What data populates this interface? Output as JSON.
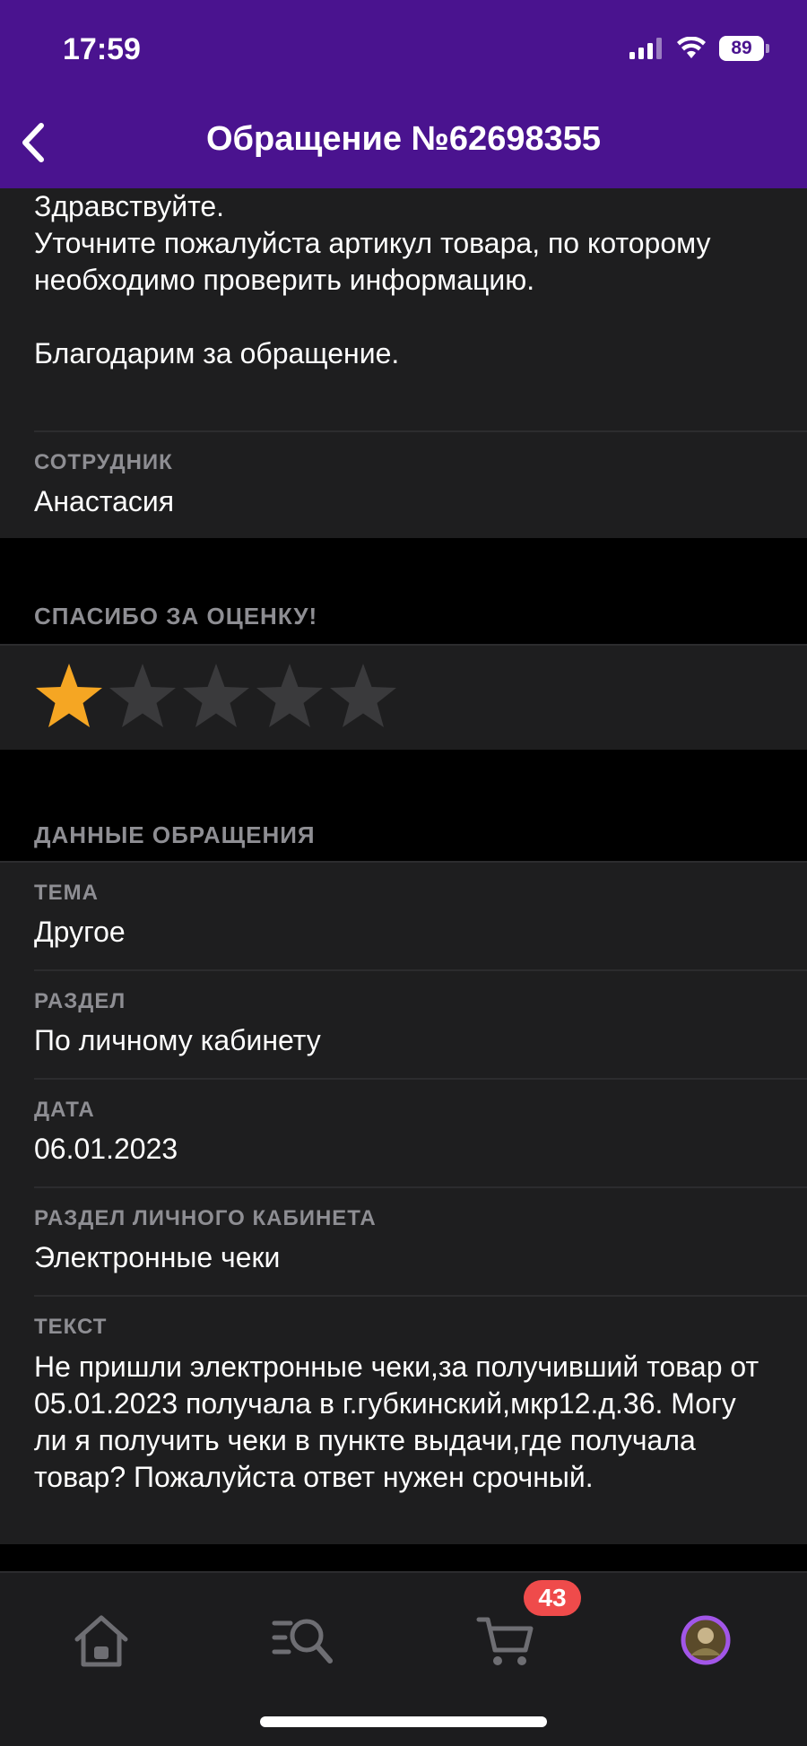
{
  "status_bar": {
    "time": "17:59",
    "battery": "89"
  },
  "header": {
    "title": "Обращение №62698355"
  },
  "response": {
    "message": "Здравствуйте.\nУточните пожалуйста артикул товара, по которому необходимо проверить информацию.\n\nБлагодарим за обращение.",
    "employee_label": "СОТРУДНИК",
    "employee_name": "Анастасия"
  },
  "rating": {
    "label": "СПАСИБО ЗА ОЦЕНКУ!",
    "value": 1,
    "max": 5,
    "active_color": "#f5a623",
    "inactive_color": "#3a3a3c"
  },
  "details": {
    "section_label": "ДАННЫЕ ОБРАЩЕНИЯ",
    "topic_label": "ТЕМА",
    "topic_value": "Другое",
    "section_field_label": "РАЗДЕЛ",
    "section_field_value": "По личному кабинету",
    "date_label": "ДАТА",
    "date_value": "06.01.2023",
    "cabinet_section_label": "РАЗДЕЛ ЛИЧНОГО КАБИНЕТА",
    "cabinet_section_value": "Электронные чеки",
    "text_label": "ТЕКСТ",
    "text_value": "Не пришли электронные чеки,за получивший товар от 05.01.2023 получала в г.губкинский,мкр12.д.36. Могу ли я получить чеки в пункте выдачи,где получала товар? Пожалуйста ответ нужен срочный."
  },
  "tabbar": {
    "cart_badge": "43",
    "items": [
      "home-icon",
      "catalog-search-icon",
      "cart-icon",
      "profile-avatar"
    ]
  },
  "colors": {
    "header_bg": "#4a138f",
    "card_bg": "#1e1e1f",
    "badge": "#ef4b4b",
    "avatar_ring": "#a256e8"
  }
}
